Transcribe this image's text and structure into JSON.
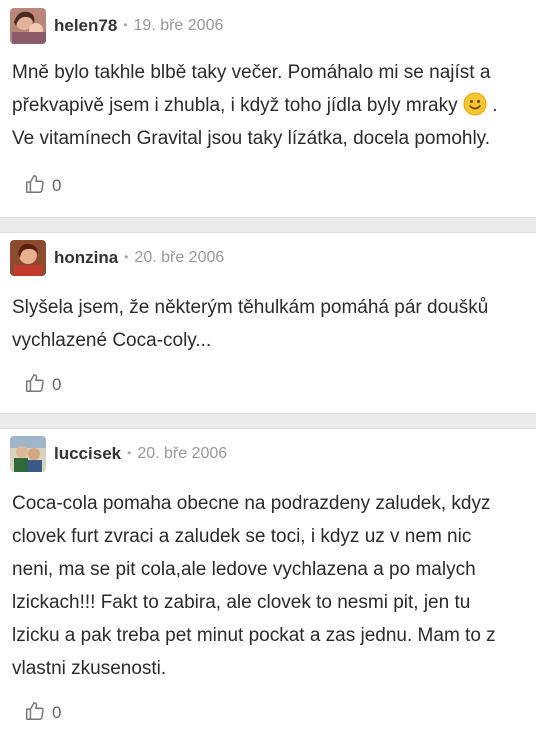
{
  "posts": [
    {
      "username": "helen78",
      "separator": "•",
      "date": "19. bře 2006",
      "text_before_emoji": "Mně bylo takhle blbě taky večer. Pomáhalo mi se najíst a překvapivě jsem i zhubla, i když toho jídla byly mraky ",
      "emoji": "smiley-emoji",
      "text_after_emoji": " . Ve vitamínech Gravital jsou taky lízátka, docela pomohly.",
      "likes": "0"
    },
    {
      "username": "honzina",
      "separator": "•",
      "date": "20. bře 2006",
      "text": "Slyšela jsem, že některým těhulkám pomáhá pár doušků vychlazené Coca-coly...",
      "likes": "0"
    },
    {
      "username": "luccisek",
      "separator": "•",
      "date": "20. bře 2006",
      "text": "Coca-cola pomaha obecne na podrazdeny zaludek, kdyz clovek furt zvraci a zaludek se toci, i kdyz uz v nem nic neni, ma se pit cola,ale ledove vychlazena a po malych lzickach!!! Fakt to zabira, ale clovek to nesmi pit, jen tu lzicku a pak treba pet minut pockat a zas jednu. Mam to z vlastni zkusenosti.",
      "likes": "0"
    }
  ],
  "colors": {
    "divider": "#ebebeb",
    "date": "#999999",
    "emoji": "#f7c533"
  },
  "icons": {
    "like": "thumbs-up-icon"
  }
}
